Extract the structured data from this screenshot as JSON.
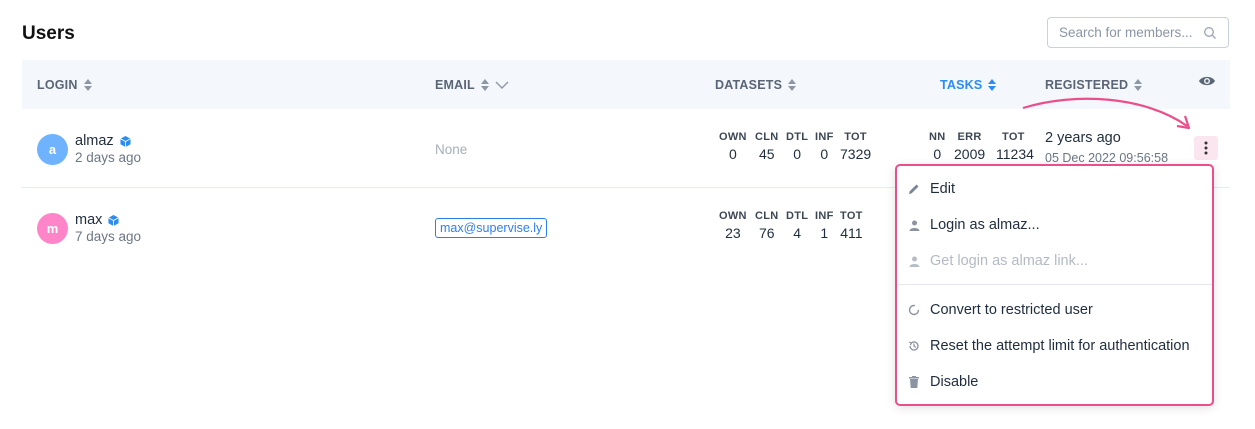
{
  "page": {
    "title": "Users"
  },
  "search": {
    "placeholder": "Search for members..."
  },
  "columns": {
    "login": "LOGIN",
    "email": "EMAIL",
    "datasets": "DATASETS",
    "tasks": "TASKS",
    "registered": "REGISTERED"
  },
  "dataset_headers": [
    "OWN",
    "CLN",
    "DTL",
    "INF",
    "TOT"
  ],
  "task_headers": [
    "NN",
    "ERR",
    "TOT"
  ],
  "rows": [
    {
      "initial": "a",
      "avatar_color": "#6fb3ff",
      "login": "almaz",
      "last_seen": "2 days ago",
      "email": "None",
      "datasets": [
        "0",
        "45",
        "0",
        "0",
        "7329"
      ],
      "tasks": [
        "0",
        "2009",
        "11234"
      ],
      "registered": "2 years ago",
      "registered_date": "05 Dec 2022 09:56:58"
    },
    {
      "initial": "m",
      "avatar_color": "#ff85c8",
      "login": "max",
      "last_seen": "7 days ago",
      "email": "max@supervise.ly",
      "datasets": [
        "23",
        "76",
        "4",
        "1",
        "411"
      ]
    }
  ],
  "context_menu": {
    "items": [
      {
        "label": "Edit",
        "icon": "pencil-icon",
        "disabled": false
      },
      {
        "label": "Login as almaz...",
        "icon": "user-icon",
        "disabled": false
      },
      {
        "label": "Get login as almaz link...",
        "icon": "user-icon",
        "disabled": true
      },
      {
        "label": "Convert to restricted user",
        "icon": "circle-progress-icon",
        "disabled": false
      },
      {
        "label": "Reset the attempt limit for authentication",
        "icon": "history-icon",
        "disabled": false
      },
      {
        "label": "Disable",
        "icon": "trash-icon",
        "disabled": false
      }
    ]
  },
  "colors": {
    "accent": "#2d8cf0",
    "highlight": "#ea4f8c",
    "header_bg": "#f4f7fb"
  }
}
